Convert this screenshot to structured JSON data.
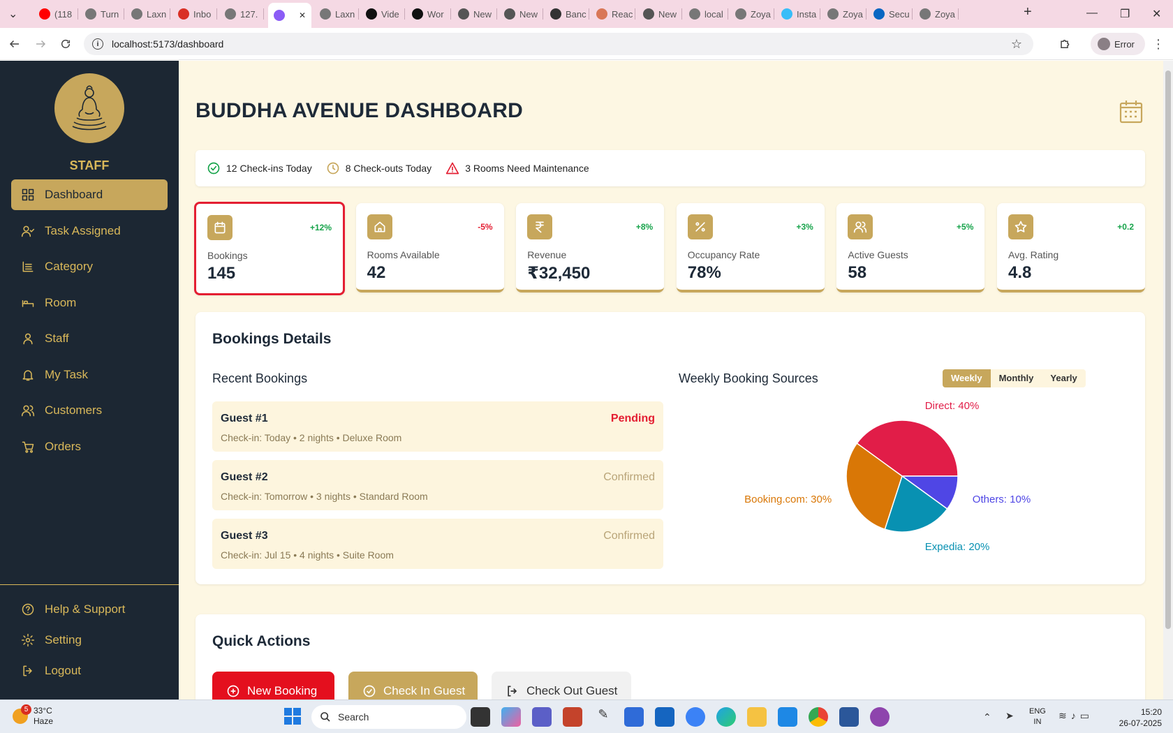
{
  "browser": {
    "tabs": [
      {
        "label": "(118",
        "icon": "youtube-icon",
        "color": "#ff0000"
      },
      {
        "label": "Turn",
        "icon": "globe-icon",
        "color": "#777"
      },
      {
        "label": "Laxn",
        "icon": "globe-icon",
        "color": "#777"
      },
      {
        "label": "Inbo",
        "icon": "gmail-icon",
        "color": "#d93025"
      },
      {
        "label": "127.",
        "icon": "globe-icon",
        "color": "#777"
      },
      {
        "label": "",
        "icon": "vite-icon",
        "color": "#8b5cf6"
      },
      {
        "label": "Laxn",
        "icon": "globe-icon",
        "color": "#777"
      },
      {
        "label": "Vide",
        "icon": "video-icon",
        "color": "#111"
      },
      {
        "label": "Wor",
        "icon": "s-icon",
        "color": "#111"
      },
      {
        "label": "New",
        "icon": "globe-icon",
        "color": "#555"
      },
      {
        "label": "New",
        "icon": "globe-icon",
        "color": "#555"
      },
      {
        "label": "Banc",
        "icon": "chatgpt-icon",
        "color": "#333"
      },
      {
        "label": "Reac",
        "icon": "claude-icon",
        "color": "#d97757"
      },
      {
        "label": "New",
        "icon": "globe-icon",
        "color": "#555"
      },
      {
        "label": "local",
        "icon": "globe-icon",
        "color": "#777"
      },
      {
        "label": "Zoya",
        "icon": "globe-icon",
        "color": "#777"
      },
      {
        "label": "Insta",
        "icon": "tailwind-icon",
        "color": "#38bdf8"
      },
      {
        "label": "Zoya",
        "icon": "globe-icon",
        "color": "#777"
      },
      {
        "label": "Secu",
        "icon": "linkedin-icon",
        "color": "#0a66c2"
      },
      {
        "label": "Zoya",
        "icon": "globe-icon",
        "color": "#777"
      }
    ],
    "url": "localhost:5173/dashboard",
    "profile_label": "Error"
  },
  "sidebar": {
    "title": "STAFF",
    "nav": [
      {
        "label": "Dashboard",
        "icon": "dashboard-icon",
        "active": true
      },
      {
        "label": "Task Assigned",
        "icon": "user-check-icon"
      },
      {
        "label": "Category",
        "icon": "category-icon"
      },
      {
        "label": "Room",
        "icon": "bed-icon"
      },
      {
        "label": "Staff",
        "icon": "user-icon"
      },
      {
        "label": "My Task",
        "icon": "bell-icon"
      },
      {
        "label": "Customers",
        "icon": "users-icon"
      },
      {
        "label": "Orders",
        "icon": "cart-icon"
      }
    ],
    "footer": [
      {
        "label": "Help & Support",
        "icon": "help-icon"
      },
      {
        "label": "Setting",
        "icon": "gear-icon"
      },
      {
        "label": "Logout",
        "icon": "logout-icon"
      }
    ]
  },
  "header": {
    "title": "BUDDHA AVENUE DASHBOARD"
  },
  "alerts": [
    {
      "text": "12 Check-ins Today",
      "icon": "check-circle-icon",
      "color": "#16a34a"
    },
    {
      "text": "8 Check-outs Today",
      "icon": "clock-icon",
      "color": "#c7a75c"
    },
    {
      "text": "3 Rooms Need Maintenance",
      "icon": "warning-icon",
      "color": "#e41e32"
    }
  ],
  "stats": [
    {
      "label": "Bookings",
      "value": "145",
      "change": "+12%",
      "icon": "calendar-icon",
      "positive": true,
      "selected": true
    },
    {
      "label": "Rooms Available",
      "value": "42",
      "change": "-5%",
      "icon": "home-icon",
      "positive": false
    },
    {
      "label": "Revenue",
      "value": "₹32,450",
      "change": "+8%",
      "icon": "rupee-icon",
      "positive": true
    },
    {
      "label": "Occupancy Rate",
      "value": "78%",
      "change": "+3%",
      "icon": "percent-icon",
      "positive": true
    },
    {
      "label": "Active Guests",
      "value": "58",
      "change": "+5%",
      "icon": "users-icon",
      "positive": true
    },
    {
      "label": "Avg. Rating",
      "value": "4.8",
      "change": "+0.2",
      "icon": "star-icon",
      "positive": true
    }
  ],
  "bookings_details": {
    "title": "Bookings Details",
    "recent_title": "Recent Bookings",
    "recent": [
      {
        "guest": "Guest #1",
        "details": "Check-in: Today • 2 nights • Deluxe Room",
        "status": "Pending"
      },
      {
        "guest": "Guest #2",
        "details": "Check-in: Tomorrow • 3 nights • Standard Room",
        "status": "Confirmed"
      },
      {
        "guest": "Guest #3",
        "details": "Check-in: Jul 15 • 4 nights • Suite Room",
        "status": "Confirmed"
      }
    ],
    "sources_title": "Weekly Booking Sources",
    "periods": [
      "Weekly",
      "Monthly",
      "Yearly"
    ],
    "active_period": "Weekly"
  },
  "chart_data": {
    "type": "pie",
    "title": "Weekly Booking Sources",
    "slices": [
      {
        "label": "Direct",
        "value": 40,
        "color": "#e11d48",
        "text": "Direct: 40%"
      },
      {
        "label": "Others",
        "value": 10,
        "color": "#4f46e5",
        "text": "Others: 10%"
      },
      {
        "label": "Expedia",
        "value": 20,
        "color": "#0891b2",
        "text": "Expedia: 20%"
      },
      {
        "label": "Booking.com",
        "value": 30,
        "color": "#d97706",
        "text": "Booking.com: 30%"
      }
    ]
  },
  "quick_actions": {
    "title": "Quick Actions",
    "buttons": [
      {
        "label": "New Booking",
        "icon": "plus-circle-icon"
      },
      {
        "label": "Check In Guest",
        "icon": "check-circle-icon"
      },
      {
        "label": "Check Out Guest",
        "icon": "logout-icon"
      }
    ]
  },
  "taskbar": {
    "weather_temp": "33°C",
    "weather_desc": "Haze",
    "weather_badge": "5",
    "search_placeholder": "Search",
    "lang_top": "ENG",
    "lang_bottom": "IN",
    "time": "15:20",
    "date": "26-07-2025"
  },
  "colors": {
    "gold": "#c7a75c",
    "navy": "#1c2733",
    "cream": "#fdf7e3",
    "red": "#e41e32",
    "green": "#16a34a"
  }
}
